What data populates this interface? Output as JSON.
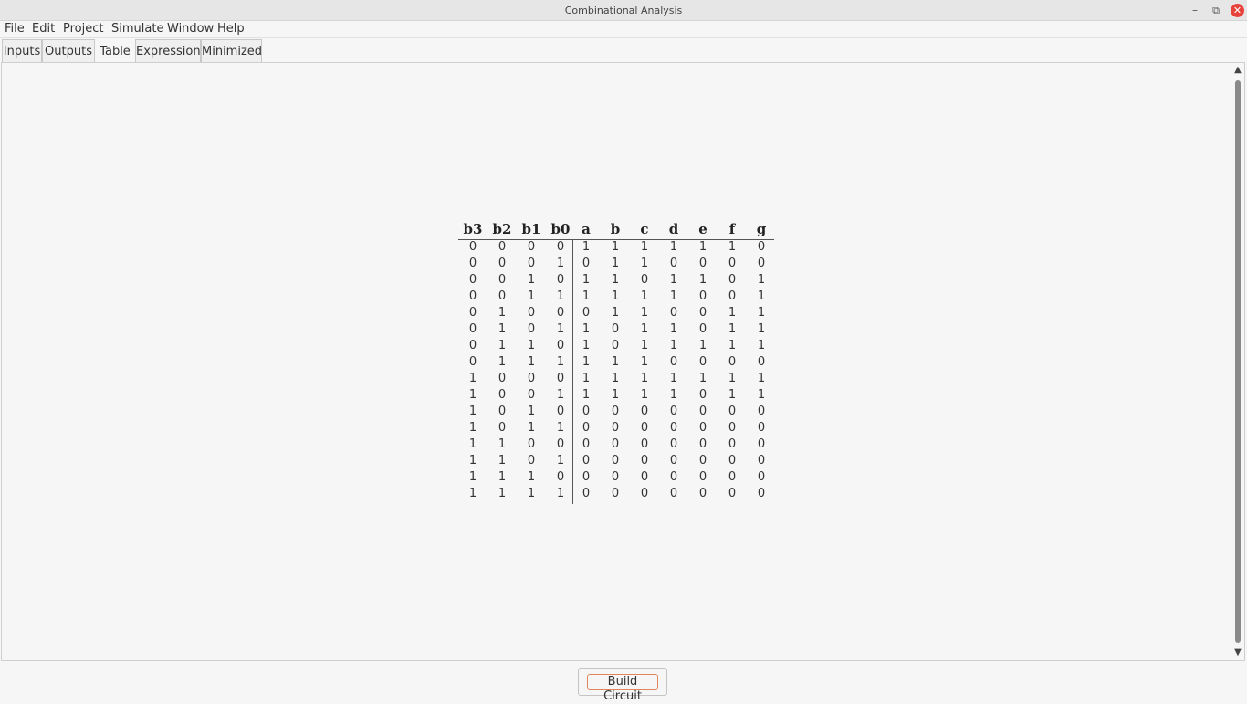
{
  "window": {
    "title": "Combinational Analysis",
    "controls": {
      "minimize": "–",
      "restore": "⧉",
      "close": "✕"
    },
    "close_color": "#e8433a"
  },
  "menu": [
    "File",
    "Edit",
    "Project",
    "Simulate",
    "Window",
    "Help"
  ],
  "tabs": [
    {
      "label": "Inputs",
      "active": false
    },
    {
      "label": "Outputs",
      "active": false
    },
    {
      "label": "Table",
      "active": true
    },
    {
      "label": "Expression",
      "active": false
    },
    {
      "label": "Minimized",
      "active": false
    }
  ],
  "table": {
    "inputs": [
      "b3",
      "b2",
      "b1",
      "b0"
    ],
    "outputs": [
      "a",
      "b",
      "c",
      "d",
      "e",
      "f",
      "g"
    ],
    "rows": [
      [
        "0",
        "0",
        "0",
        "0",
        "1",
        "1",
        "1",
        "1",
        "1",
        "1",
        "0"
      ],
      [
        "0",
        "0",
        "0",
        "1",
        "0",
        "1",
        "1",
        "0",
        "0",
        "0",
        "0"
      ],
      [
        "0",
        "0",
        "1",
        "0",
        "1",
        "1",
        "0",
        "1",
        "1",
        "0",
        "1"
      ],
      [
        "0",
        "0",
        "1",
        "1",
        "1",
        "1",
        "1",
        "1",
        "0",
        "0",
        "1"
      ],
      [
        "0",
        "1",
        "0",
        "0",
        "0",
        "1",
        "1",
        "0",
        "0",
        "1",
        "1"
      ],
      [
        "0",
        "1",
        "0",
        "1",
        "1",
        "0",
        "1",
        "1",
        "0",
        "1",
        "1"
      ],
      [
        "0",
        "1",
        "1",
        "0",
        "1",
        "0",
        "1",
        "1",
        "1",
        "1",
        "1"
      ],
      [
        "0",
        "1",
        "1",
        "1",
        "1",
        "1",
        "1",
        "0",
        "0",
        "0",
        "0"
      ],
      [
        "1",
        "0",
        "0",
        "0",
        "1",
        "1",
        "1",
        "1",
        "1",
        "1",
        "1"
      ],
      [
        "1",
        "0",
        "0",
        "1",
        "1",
        "1",
        "1",
        "1",
        "0",
        "1",
        "1"
      ],
      [
        "1",
        "0",
        "1",
        "0",
        "0",
        "0",
        "0",
        "0",
        "0",
        "0",
        "0"
      ],
      [
        "1",
        "0",
        "1",
        "1",
        "0",
        "0",
        "0",
        "0",
        "0",
        "0",
        "0"
      ],
      [
        "1",
        "1",
        "0",
        "0",
        "0",
        "0",
        "0",
        "0",
        "0",
        "0",
        "0"
      ],
      [
        "1",
        "1",
        "0",
        "1",
        "0",
        "0",
        "0",
        "0",
        "0",
        "0",
        "0"
      ],
      [
        "1",
        "1",
        "1",
        "0",
        "0",
        "0",
        "0",
        "0",
        "0",
        "0",
        "0"
      ],
      [
        "1",
        "1",
        "1",
        "1",
        "0",
        "0",
        "0",
        "0",
        "0",
        "0",
        "0"
      ]
    ]
  },
  "scrollbar": {
    "up": "▲",
    "down": "▼"
  },
  "build_button": {
    "label": "Build Circuit",
    "focus_color": "#e0865c"
  }
}
